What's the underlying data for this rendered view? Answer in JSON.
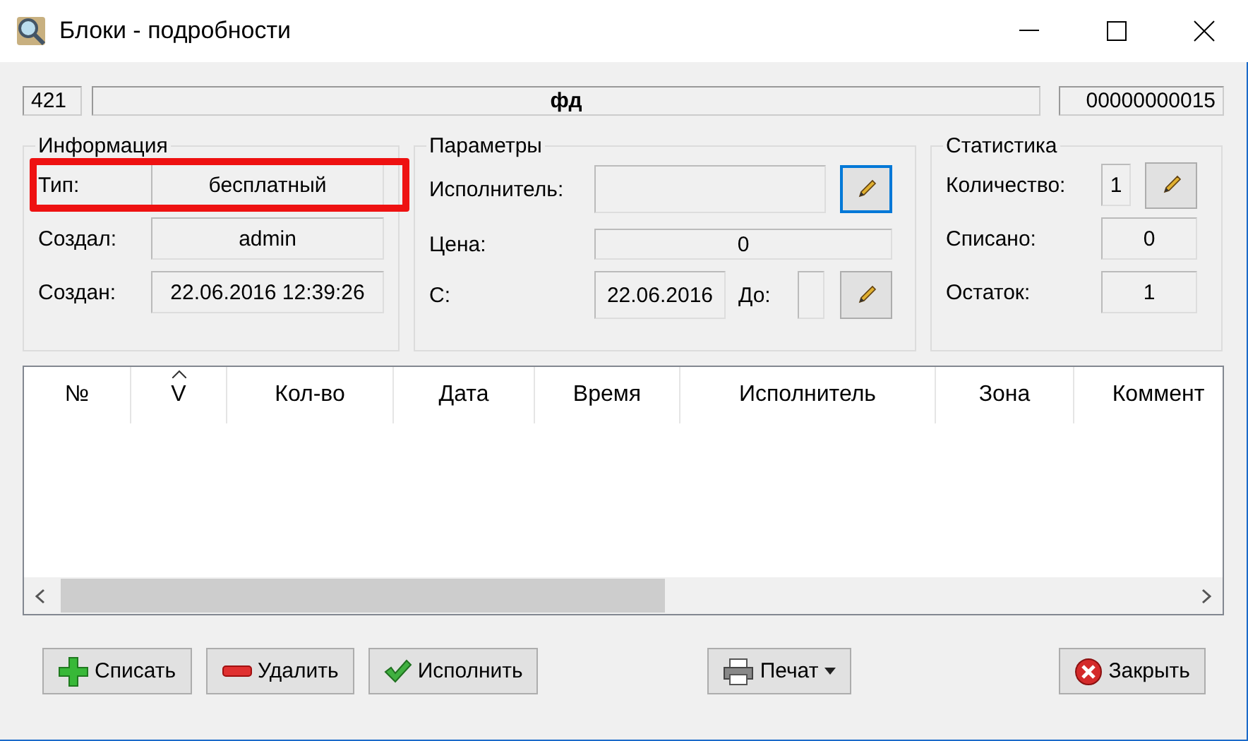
{
  "window": {
    "title": "Блоки - подробности"
  },
  "header": {
    "id": "421",
    "name": "фд",
    "code": "00000000015"
  },
  "info": {
    "title": "Информация",
    "fields": [
      {
        "label": "Тип:",
        "value": "бесплатный",
        "highlighted": true
      },
      {
        "label": "Создал:",
        "value": "admin",
        "highlighted": false
      },
      {
        "label": "Создан:",
        "value": "22.06.2016 12:39:26",
        "highlighted": false
      }
    ]
  },
  "params": {
    "title": "Параметры",
    "executor_label": "Исполнитель:",
    "executor_edit": {
      "focused": true
    },
    "price_label": "Цена:",
    "price_value": "0",
    "from_label": "С:",
    "from_value": "22.06.2016",
    "to_label": "До:",
    "date_edit": {
      "focused": false
    }
  },
  "stats": {
    "title": "Статистика",
    "rows": [
      {
        "label": "Количество:",
        "value": "1",
        "editable": true
      },
      {
        "label": "Списано:",
        "value": "0",
        "editable": false
      },
      {
        "label": "Остаток:",
        "value": "1",
        "editable": false
      }
    ]
  },
  "table": {
    "columns": [
      {
        "label": "№",
        "sorted": false
      },
      {
        "label": "V",
        "sorted": true
      },
      {
        "label": "Кол-во",
        "sorted": false
      },
      {
        "label": "Дата",
        "sorted": false
      },
      {
        "label": "Время",
        "sorted": false
      },
      {
        "label": "Исполнитель",
        "sorted": false
      },
      {
        "label": "Зона",
        "sorted": false
      },
      {
        "label": "Коммент",
        "sorted": false
      }
    ]
  },
  "buttons_left": [
    {
      "label": "Списать",
      "kind": "add"
    },
    {
      "label": "Удалить",
      "kind": "remove"
    },
    {
      "label": "Исполнить",
      "kind": "apply"
    }
  ],
  "buttons_center": [
    {
      "label": "Печат",
      "kind": "print"
    }
  ],
  "buttons_right": [
    {
      "label": "Закрыть",
      "kind": "close"
    }
  ]
}
